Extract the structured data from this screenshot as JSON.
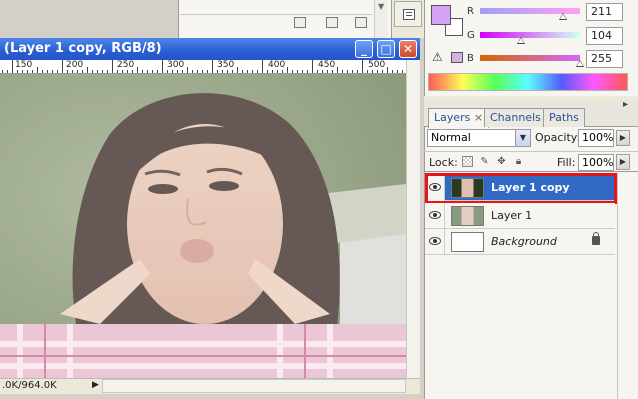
{
  "document": {
    "title": "(Layer 1 copy, RGB/8)",
    "ruler_labels": [
      "150",
      "200",
      "250",
      "300",
      "350",
      "400",
      "450",
      "500"
    ],
    "status": ".0K/964.0K"
  },
  "color_panel": {
    "foreground": "#d3a2f5",
    "background": "#ffffff",
    "channels": [
      {
        "label": "R",
        "value": "211",
        "fraction": 0.827
      },
      {
        "label": "G",
        "value": "104",
        "fraction": 0.408
      },
      {
        "label": "B",
        "value": "255",
        "fraction": 1.0
      }
    ],
    "warning_icon": "gamut-warning-icon"
  },
  "layers_panel": {
    "tabs": [
      {
        "label": "Layers",
        "active": true
      },
      {
        "label": "Channels",
        "active": false
      },
      {
        "label": "Paths",
        "active": false
      }
    ],
    "tab_close": "×",
    "blend_mode": "Normal",
    "opacity_label": "Opacity:",
    "opacity_value": "100%",
    "lock_label": "Lock:",
    "fill_label": "Fill:",
    "fill_value": "100%",
    "layers": [
      {
        "name": "Layer 1 copy",
        "selected": true,
        "visible": true
      },
      {
        "name": "Layer 1",
        "selected": false,
        "visible": true
      },
      {
        "name": "Background",
        "selected": false,
        "visible": true,
        "locked": true
      }
    ]
  },
  "colors": {
    "selection": "#316ac5",
    "highlight_outline": "#e8141c",
    "titlebar": "#2a5ed4"
  }
}
